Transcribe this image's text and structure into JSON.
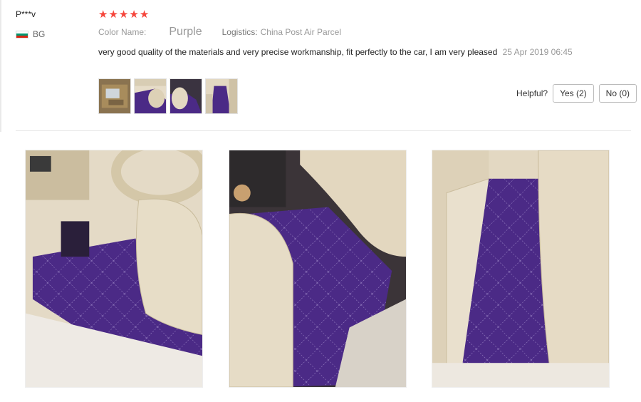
{
  "review": {
    "reviewer": "P***v",
    "country_code": "BG",
    "rating": 5,
    "color_label": "Color Name:",
    "color_value": "Purple",
    "logistics_label": "Logistics:",
    "logistics_value": "China Post Air Parcel",
    "text": "very good quality of the materials and very precise workmanship, fit perfectly to the car, I am very pleased",
    "date": "25 Apr 2019 06:45"
  },
  "helpful": {
    "label": "Helpful?",
    "yes_label": "Yes (2)",
    "no_label": "No (0)"
  },
  "photos": {
    "thumbnail_count": 4,
    "large_count": 3
  },
  "colors": {
    "star": "#f5463c",
    "mat_purple": "#4b2a86",
    "beige": "#e6dcc8",
    "flag": [
      "#ffffff",
      "#00966e",
      "#d62612"
    ]
  },
  "icons": {
    "rating": "star-icon",
    "flag": "bulgaria-flag-icon"
  }
}
